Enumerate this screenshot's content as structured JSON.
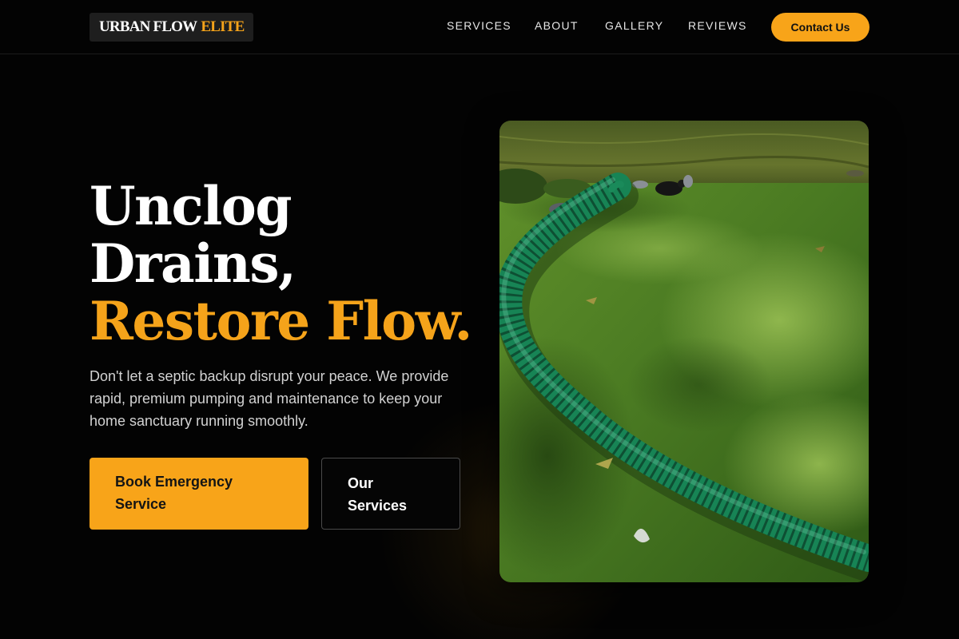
{
  "brand": {
    "name_main": "URBAN FLOW",
    "name_accent": "ELITE",
    "accent_color": "#f5a31a"
  },
  "nav": {
    "links": [
      "SERVICES",
      "ABOUT",
      "GALLERY",
      "REVIEWS"
    ],
    "cta_label": "Contact Us"
  },
  "hero": {
    "title_line1": "Unclog",
    "title_line2": "Drains,",
    "title_line3": "Restore Flow.",
    "description": "Don't let a septic backup disrupt your peace. We provide rapid, premium pumping and maintenance to keep your home sanctuary running smoothly.",
    "primary_button": "Book Emergency Service",
    "secondary_button": "Our Services",
    "image_subject": "green suction hose lying on grass beside a pond with pigeons"
  },
  "colors": {
    "background": "#030303",
    "accent": "#f8a419",
    "text": "#ffffff",
    "muted_text": "#d2d2d2"
  }
}
